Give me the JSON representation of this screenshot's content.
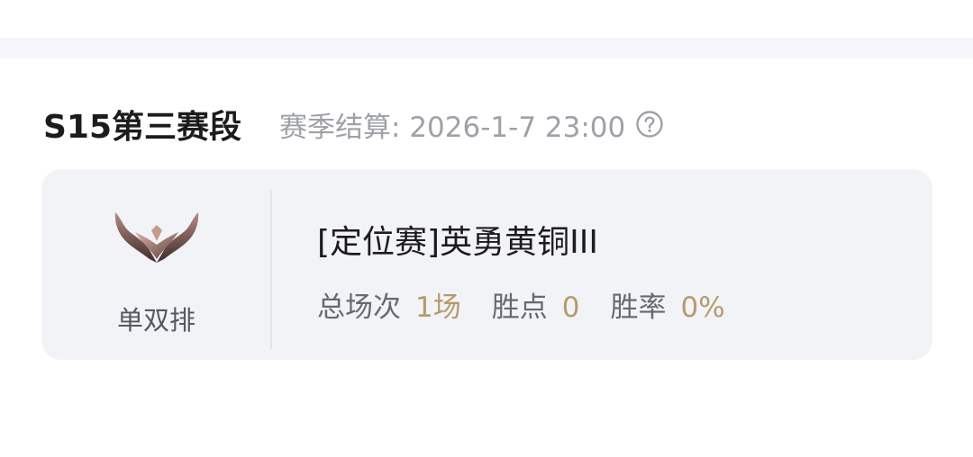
{
  "season": {
    "title": "S15第三赛段",
    "settlement": "赛季结算: 2026-1-7 23:00"
  },
  "rank_card": {
    "queue": "单双排",
    "rank_name": "[定位赛]英勇黄铜III",
    "stats": [
      {
        "label": "总场次",
        "value": "1场"
      },
      {
        "label": "胜点",
        "value": "0"
      },
      {
        "label": "胜率",
        "value": "0%"
      }
    ]
  },
  "colors": {
    "accent_value": "#b59a6c",
    "card_bg": "#f2f3f7",
    "muted_text": "#9ea1a7"
  },
  "icons": {
    "help": "question-circle-icon",
    "emblem": "bronze-rank-emblem"
  }
}
